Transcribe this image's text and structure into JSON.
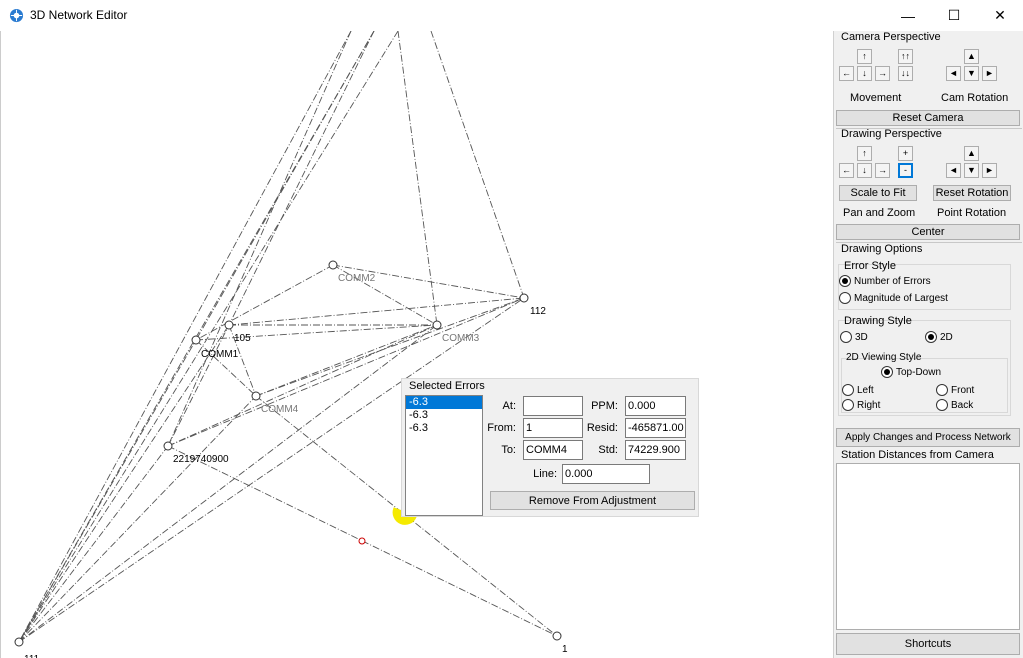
{
  "window": {
    "title": "3D Network Editor",
    "minimize": "—",
    "maximize": "☐",
    "close": "✕"
  },
  "network": {
    "labels": {
      "comm2": "COMM2",
      "comm3": "COMM3",
      "comm1": "COMM1",
      "comm4": "COMM4",
      "n105": "105",
      "n112": "112",
      "n2219": "2219740900",
      "n1": "1",
      "n111": "111"
    }
  },
  "selected_errors": {
    "title": "Selected Errors",
    "items": [
      "-6.3",
      "-6.3",
      "-6.3"
    ],
    "at_label": "At:",
    "at_value": "",
    "from_label": "From:",
    "from_value": "1",
    "to_label": "To:",
    "to_value": "COMM4",
    "ppm_label": "PPM:",
    "ppm_value": "0.000",
    "resid_label": "Resid:",
    "resid_value": "-465871.00",
    "std_label": "Std:",
    "std_value": "74229.900",
    "line_label": "Line:",
    "line_value": "0.000",
    "remove_button": "Remove From Adjustment"
  },
  "panel": {
    "camera_title": "Camera Perspective",
    "cam_buttons": {
      "up": "↑",
      "down": "↓",
      "left": "←",
      "right": "→",
      "up2": "↑↑",
      "down2": "↓↓",
      "rot_up": "▲",
      "rot_down": "▼",
      "rot_left": "◄",
      "rot_right": "►"
    },
    "movement_label": "Movement",
    "cam_rotation_label": "Cam Rotation",
    "reset_camera": "Reset Camera",
    "drawing_title": "Drawing Perspective",
    "draw_buttons": {
      "up": "↑",
      "down": "↓",
      "left": "←",
      "right": "→",
      "zoom_in": "+",
      "zoom_out": "-",
      "rot_up": "▲",
      "rot_down": "▼",
      "rot_left": "◄",
      "rot_right": "►"
    },
    "scale_to_fit": "Scale to Fit",
    "reset_rotation": "Reset Rotation",
    "pan_zoom_label": "Pan and Zoom",
    "point_rotation_label": "Point Rotation",
    "center": "Center",
    "drawing_options_title": "Drawing Options",
    "error_style_title": "Error Style",
    "number_of_errors": "Number of Errors",
    "magnitude_of_largest": "Magnitude of Largest",
    "drawing_style_title": "Drawing Style",
    "style_3d": "3D",
    "style_2d": "2D",
    "viewing_style_title": "2D Viewing Style",
    "top_down": "Top-Down",
    "left": "Left",
    "front": "Front",
    "right": "Right",
    "back": "Back",
    "apply_button": "Apply Changes and Process Network",
    "station_distances_title": "Station Distances from Camera",
    "shortcuts": "Shortcuts"
  }
}
